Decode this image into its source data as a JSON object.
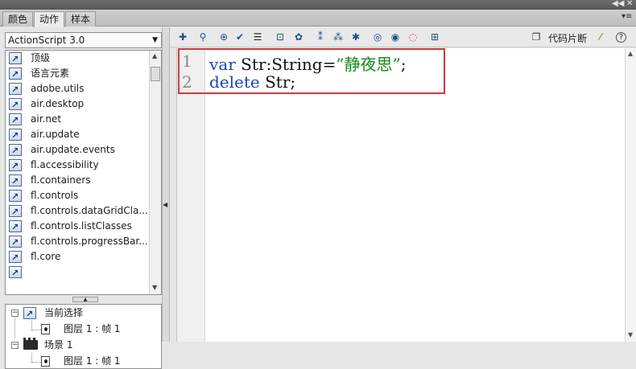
{
  "panel_tabs": [
    {
      "label": "颜色"
    },
    {
      "label": "动作"
    },
    {
      "label": "样本"
    }
  ],
  "language_dropdown": {
    "selected": "ActionScript 3.0"
  },
  "tree_items": [
    "顶级",
    "语言元素",
    "adobe.utils",
    "air.desktop",
    "air.net",
    "air.update",
    "air.update.events",
    "fl.accessibility",
    "fl.containers",
    "fl.controls",
    "fl.controls.dataGridCla...",
    "fl.controls.listClasses",
    "fl.controls.progressBar...",
    "fl.core"
  ],
  "scene_tree": {
    "current_selection": "当前选择",
    "current_layer": "图层 1 : 帧 1",
    "scene": "场景 1",
    "scene_layer": "图层 1 : 帧 1"
  },
  "toolbar": {
    "snippets_label": "代码片断"
  },
  "code": {
    "line_numbers": [
      "1",
      "2"
    ],
    "line1": {
      "kw": "var",
      "mid": " Str:String=",
      "str": "”静夜思”",
      "end": ";"
    },
    "line2": {
      "kw": "delete",
      "rest": " Str;"
    }
  },
  "icons": {
    "add": "plus-icon",
    "find": "find-icon",
    "target": "target-icon",
    "check": "check-syntax-icon",
    "format": "auto-format-icon",
    "hint": "code-hint-icon",
    "debug": "debug-icon",
    "collapse": "collapse-icon",
    "collapse_sel": "collapse-selection-icon",
    "expand": "expand-all-icon",
    "comment": "comment-icon",
    "line_comment": "line-comment-icon",
    "uncomment": "uncomment-icon",
    "script_assist": "script-assist-icon",
    "snippets": "snippets-icon",
    "wand": "wand-icon",
    "help": "help-icon"
  }
}
